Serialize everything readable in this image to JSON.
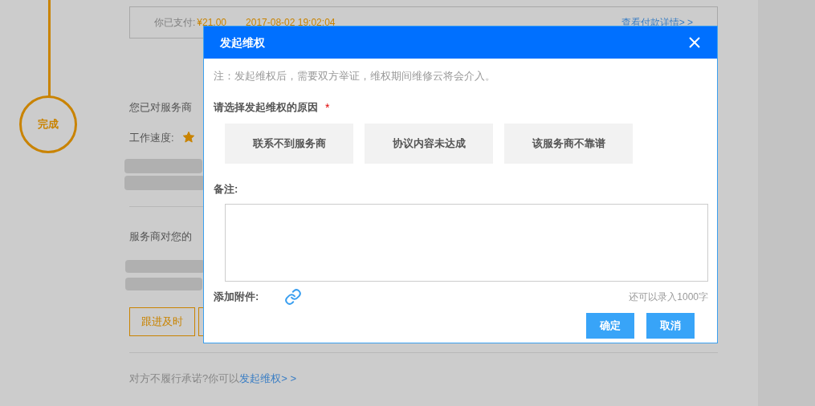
{
  "timeline": {
    "step_label": "完成"
  },
  "payment": {
    "label": "你已支付:",
    "amount": "¥21.00",
    "time": "2017-08-02 19:02:04",
    "details_link": "查看付款详情> >"
  },
  "rating_section": {
    "intro": "您已对服务商",
    "criteria": [
      {
        "label": "工作速度:"
      }
    ]
  },
  "review_section": {
    "intro": "服务商对您的",
    "tags": [
      "跟进及时"
    ]
  },
  "footer": {
    "prompt": "对方不履行承诺?你可以",
    "link": "发起维权> >"
  },
  "dialog": {
    "title": "发起维权",
    "note": "注：发起维权后，需要双方举证，维权期间维修云将会介入。",
    "reason_label": "请选择发起维权的原因",
    "required_mark": "*",
    "reasons": [
      {
        "label": "联系不到服务商",
        "selected": false
      },
      {
        "label": "协议内容未达成",
        "selected": false
      },
      {
        "label": "该服务商不靠谱",
        "selected": false
      }
    ],
    "remark_label": "备注:",
    "attachment_label": "添加附件:",
    "char_counter": "还可以录入1000字",
    "buttons": [
      "确定",
      "取消"
    ]
  }
}
